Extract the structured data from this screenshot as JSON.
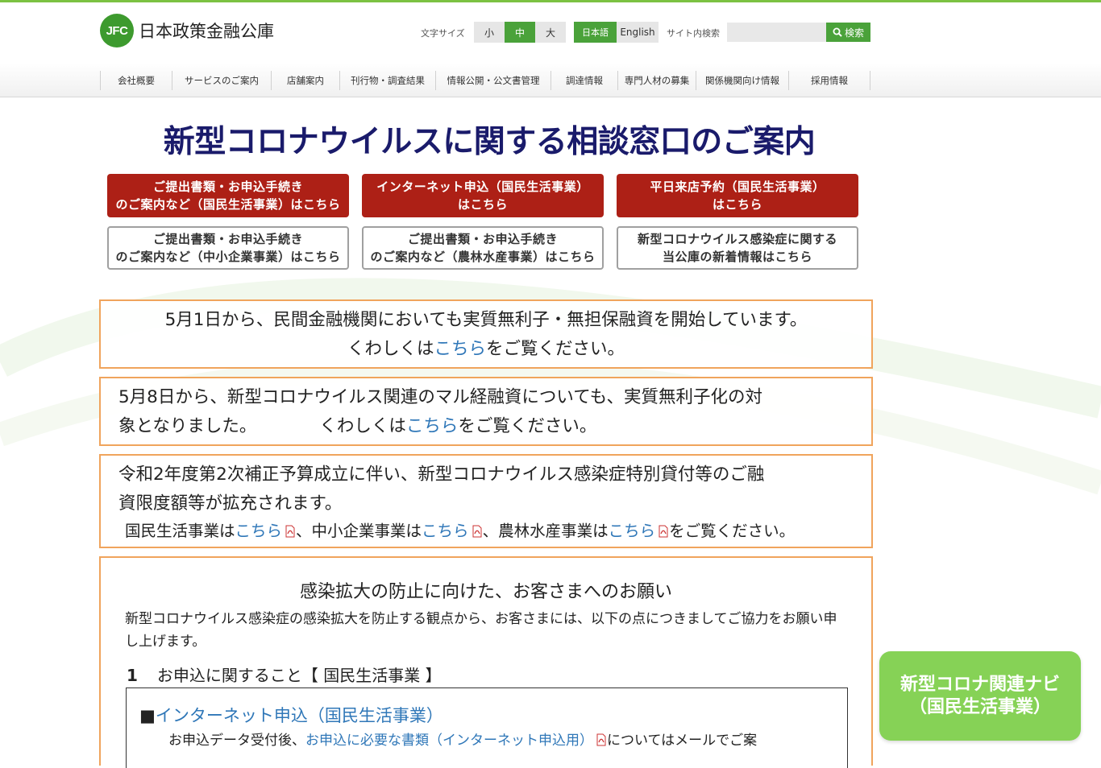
{
  "header": {
    "logo_mark": "JFC",
    "logo_text": "日本政策金融公庫",
    "font_size_label": "文字サイズ",
    "font_sizes": [
      "小",
      "中",
      "大"
    ],
    "font_size_selected": "中",
    "lang_ja": "日本語",
    "lang_en": "English",
    "site_search_label": "サイト内検索",
    "search_button": "検索"
  },
  "nav": {
    "items": [
      "会社概要",
      "サービスのご案内",
      "店舗案内",
      "刊行物・調査結果",
      "情報公開・公文書管理",
      "調達情報",
      "専門人材の募集",
      "関係機関向け情報",
      "採用情報"
    ]
  },
  "main": {
    "title": "新型コロナウイルスに関する相談窓口のご案内",
    "buttons": [
      {
        "label": "ご提出書類・お申込手続き\nのご案内など（国民生活事業）はこちら"
      },
      {
        "label": "インターネット申込（国民生活事業）\nはこちら"
      },
      {
        "label": "平日来店予約（国民生活事業）\nはこちら"
      },
      {
        "label": "ご提出書類・お申込手続き\nのご案内など（中小企業事業）はこちら"
      },
      {
        "label": "ご提出書類・お申込手続き\nのご案内など（農林水産事業）はこちら"
      },
      {
        "label": "新型コロナウイルス感染症に関する\n当公庫の新着情報はこちら"
      }
    ]
  },
  "notices": {
    "n1_line1": "5月1日から、民間金融機関においても実質無利子・無担保融資を開始しています。",
    "n1_pre": "くわしくは",
    "n1_link": "こちら",
    "n1_post": "をご覧ください。",
    "n2_line1": "5月8日から、新型コロナウイルス関連のマル経融資についても、実質無利子化の対",
    "n2_line2": "象となりました。",
    "n2_pre": "くわしくは",
    "n2_link": "こちら",
    "n2_post": "をご覧ください。",
    "n3_line1": "令和2年度第2次補正予算成立に伴い、新型コロナウイルス感染症特別貸付等のご融",
    "n3_line2": "資限度額等が拡充されます。",
    "n3_a": "国民生活事業は",
    "n3_link1": "こちら",
    "n3_b": "、中小企業事業は",
    "n3_link2": "こちら",
    "n3_c": "、農林水産事業は",
    "n3_link3": "こちら",
    "n3_d": "をご覧ください。"
  },
  "request": {
    "title": "感染拡大の防止に向けた、お客さまへのお願い",
    "body": "新型コロナウイルス感染症の感染拡大を防止する観点から、お客さまには、以下の点につきましてご協力をお願い申し上げます。",
    "section_num": "1",
    "section_title": "お申込に関すること【 国民生活事業 】",
    "item_marker": "■",
    "item_link": "インターネット申込（国民生活事業）",
    "item_text_pre": "お申込データ受付後、",
    "item_text_link": "お申込に必要な書類（インターネット申込用）",
    "item_text_post": "についてはメールでご案"
  },
  "floating": {
    "navi_label": "新型コロナ関連ナビ\n（国民生活事業）"
  },
  "colors": {
    "accent_green": "#4aa23a",
    "title_navy": "#1a1b6b",
    "button_red": "#ad2016",
    "notice_border": "#f0a45c",
    "link_blue": "#2f77b8",
    "navi_green": "#86d256"
  },
  "icons": {
    "search": "search-icon",
    "pdf": "pdf-icon"
  }
}
